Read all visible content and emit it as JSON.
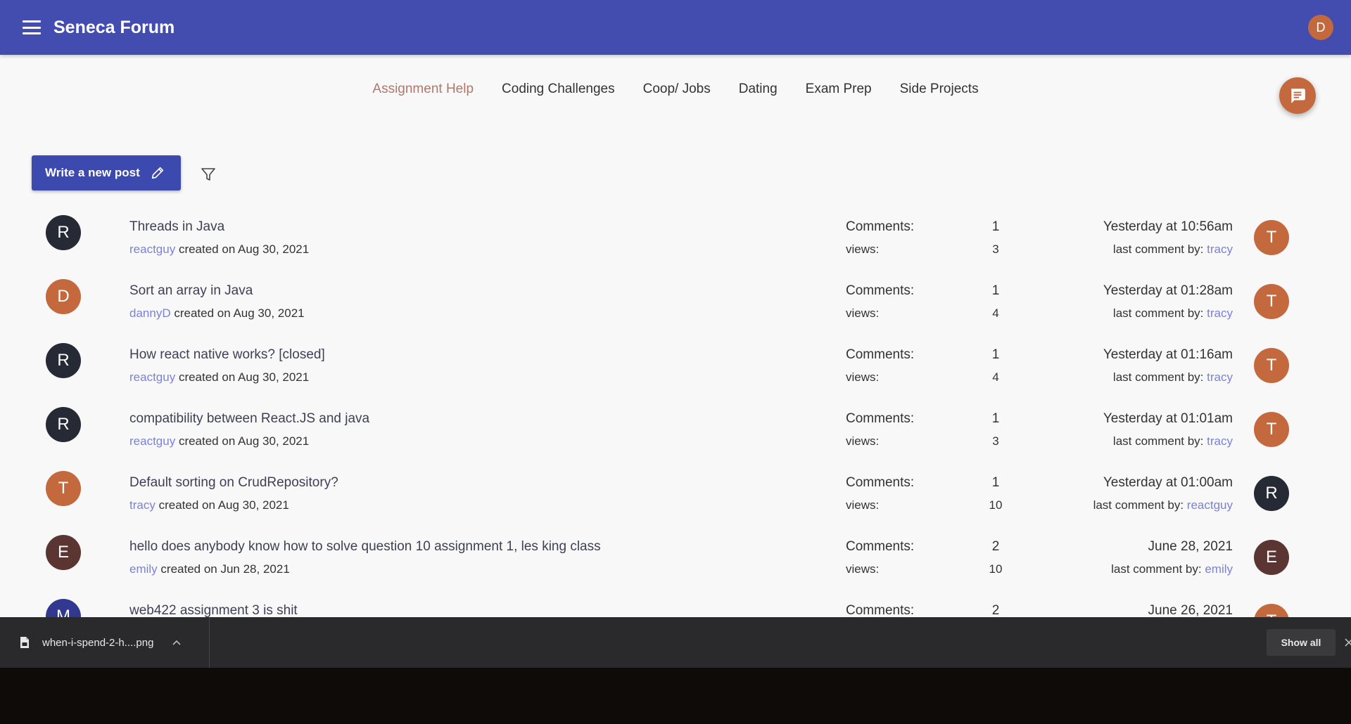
{
  "app": {
    "title": "Seneca Forum",
    "user_initial": "D"
  },
  "tabs": [
    {
      "label": "Assignment Help",
      "active": true
    },
    {
      "label": "Coding Challenges"
    },
    {
      "label": "Coop/ Jobs"
    },
    {
      "label": "Dating"
    },
    {
      "label": "Exam Prep"
    },
    {
      "label": "Side Projects"
    }
  ],
  "toolbar": {
    "write_label": "Write a new post"
  },
  "colors": {
    "appbar": "#434db0",
    "primary_button": "#3c49ae",
    "link": "#7b82d8",
    "avatar_orange": "#c4693e",
    "avatar_dark": "#262a35",
    "avatar_brown": "#5a3531",
    "avatar_navy": "#32388f"
  },
  "posts": [
    {
      "initial": "R",
      "avatar_color": "#262a35",
      "title": "Threads in Java",
      "author": "reactguy",
      "created": "created on Aug 30, 2021",
      "comments_label": "Comments:",
      "comments": "1",
      "views_label": "views:",
      "views": "3",
      "last_date": "Yesterday at 10:56am",
      "last_by_label": "last comment by:",
      "last_by": "tracy",
      "last_initial": "T",
      "last_color": "#c4693e"
    },
    {
      "initial": "D",
      "avatar_color": "#c4693e",
      "title": "Sort an array in Java",
      "author": "dannyD",
      "created": "created on Aug 30, 2021",
      "comments_label": "Comments:",
      "comments": "1",
      "views_label": "views:",
      "views": "4",
      "last_date": "Yesterday at 01:28am",
      "last_by_label": "last comment by:",
      "last_by": "tracy",
      "last_initial": "T",
      "last_color": "#c4693e"
    },
    {
      "initial": "R",
      "avatar_color": "#262a35",
      "title": "How react native works? [closed]",
      "author": "reactguy",
      "created": "created on Aug 30, 2021",
      "comments_label": "Comments:",
      "comments": "1",
      "views_label": "views:",
      "views": "4",
      "last_date": "Yesterday at 01:16am",
      "last_by_label": "last comment by:",
      "last_by": "tracy",
      "last_initial": "T",
      "last_color": "#c4693e"
    },
    {
      "initial": "R",
      "avatar_color": "#262a35",
      "title": "compatibility between React.JS and java",
      "author": "reactguy",
      "created": "created on Aug 30, 2021",
      "comments_label": "Comments:",
      "comments": "1",
      "views_label": "views:",
      "views": "3",
      "last_date": "Yesterday at 01:01am",
      "last_by_label": "last comment by:",
      "last_by": "tracy",
      "last_initial": "T",
      "last_color": "#c4693e"
    },
    {
      "initial": "T",
      "avatar_color": "#c4693e",
      "title": "Default sorting on CrudRepository?",
      "author": "tracy",
      "created": "created on Aug 30, 2021",
      "comments_label": "Comments:",
      "comments": "1",
      "views_label": "views:",
      "views": "10",
      "last_date": "Yesterday at 01:00am",
      "last_by_label": "last comment by:",
      "last_by": "reactguy",
      "last_initial": "R",
      "last_color": "#262a35"
    },
    {
      "initial": "E",
      "avatar_color": "#5a3531",
      "title": "hello does anybody know how to solve question 10 assignment 1, les king class",
      "author": "emily",
      "created": "created on Jun 28, 2021",
      "comments_label": "Comments:",
      "comments": "2",
      "views_label": "views:",
      "views": "10",
      "last_date": "June 28, 2021",
      "last_by_label": "last comment by:",
      "last_by": "emily",
      "last_initial": "E",
      "last_color": "#5a3531"
    },
    {
      "initial": "M",
      "avatar_color": "#32388f",
      "title": "web422 assignment 3 is shit",
      "author": "",
      "created": "",
      "comments_label": "Comments:",
      "comments": "2",
      "views_label": "",
      "views": "",
      "last_date": "June 26, 2021",
      "last_by_label": "",
      "last_by": "",
      "last_initial": "T",
      "last_color": "#c4693e"
    }
  ],
  "download_bar": {
    "file_name": "when-i-spend-2-h....png",
    "show_all": "Show all"
  }
}
